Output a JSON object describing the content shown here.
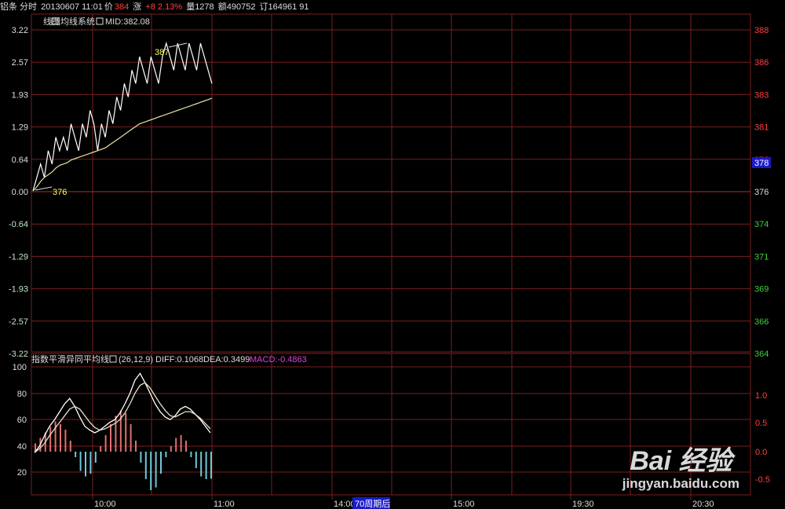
{
  "header": {
    "name": "铝条 分时",
    "date_time": "20130607 11:01",
    "price_label": "价",
    "price": "384",
    "change_label": "涨",
    "change": "+8 2.13%",
    "volume_label": "量",
    "volume": "1278",
    "amount_label": "额",
    "amount": "490752",
    "order_label": "订",
    "order": "164961 91"
  },
  "main_panel": {
    "legend_line": "线图",
    "legend_avg": "均线系统",
    "legend_mid": "MID:382.08",
    "pct_ticks": [
      "3.22",
      "2.57",
      "1.93",
      "1.29",
      "0.64",
      "0.00",
      "-0.64",
      "-1.29",
      "-1.93",
      "-2.57",
      "-3.22"
    ],
    "price_ticks": [
      "388",
      "386",
      "383",
      "381",
      "378",
      "376",
      "374",
      "371",
      "369",
      "366",
      "364"
    ],
    "current_price_tag": "378",
    "high_label": "387",
    "low_label": "376"
  },
  "macd_panel": {
    "title": "指数平滑异同平均线",
    "params": "(26,12,9)",
    "diff": "DIFF:0.1068",
    "dea": "DEA:0.3499",
    "macd": "MACD:-0.4863",
    "left_ticks": [
      "100",
      "80",
      "60",
      "40",
      "20"
    ],
    "right_ticks": [
      "1.0",
      "0.5",
      "0.0",
      "-0.5"
    ]
  },
  "time_axis": {
    "labels": [
      "10:00",
      "11:00",
      "14:00",
      "15:00",
      "19:30",
      "20:30"
    ],
    "badge": "70周期后"
  },
  "colors": {
    "grid": "#7a1f1f",
    "price_line": "#ffffff",
    "avg_line": "#e8e0a0",
    "label_yellow": "#ffff66",
    "up_red": "#ff4040",
    "down_green": "#3fcf3f",
    "macd_magenta": "#e040e0",
    "hist_up": "#e07070",
    "hist_down": "#70c8d8",
    "badge_bg": "#1a1ac8"
  },
  "watermark": {
    "brand": "Bai 经验",
    "url": "jingyan.baidu.com"
  },
  "chart_data": [
    {
      "type": "line",
      "x_unit": "minute index (session start)",
      "series": [
        {
          "values": [
            376,
            377,
            378,
            377,
            379,
            378,
            380,
            379,
            380,
            379,
            381,
            380,
            379,
            381,
            380,
            382,
            381,
            379,
            381,
            380,
            382,
            381,
            383,
            382,
            384,
            383,
            385,
            384,
            386,
            385,
            384,
            386,
            385,
            384,
            386,
            387,
            386,
            385,
            387,
            386,
            385,
            387,
            386,
            385,
            387,
            386,
            385,
            384
          ]
        },
        {
          "values": [
            376,
            376.3,
            376.7,
            377,
            377.2,
            377.4,
            377.7,
            377.9,
            378,
            378.1,
            378.3,
            378.4,
            378.5,
            378.6,
            378.7,
            378.8,
            378.9,
            379,
            379.1,
            379.2,
            379.4,
            379.6,
            379.8,
            380,
            380.2,
            380.4,
            380.6,
            380.8,
            381,
            381.1,
            381.2,
            381.3,
            381.4,
            381.5,
            381.6,
            381.7,
            381.8,
            381.9,
            382,
            382.1,
            382.2,
            382.3,
            382.4,
            382.5,
            382.6,
            382.7,
            382.8,
            382.9
          ]
        }
      ],
      "ylim": [
        364,
        388
      ]
    },
    {
      "type": "line",
      "series": [
        {
          "values": [
            35,
            40,
            48,
            55,
            60,
            66,
            72,
            76,
            70,
            62,
            55,
            52,
            50,
            52,
            55,
            58,
            60,
            65,
            72,
            80,
            90,
            95,
            88,
            80,
            72,
            66,
            62,
            60,
            63,
            68,
            70,
            68,
            64,
            60,
            55,
            50
          ]
        },
        {
          "values": [
            35,
            38,
            42,
            48,
            53,
            58,
            63,
            68,
            70,
            68,
            63,
            58,
            54,
            52,
            53,
            55,
            57,
            60,
            65,
            72,
            80,
            86,
            88,
            84,
            78,
            72,
            67,
            63,
            62,
            64,
            66,
            66,
            64,
            61,
            57,
            53
          ]
        },
        {
          "values": [
            0.15,
            0.25,
            0.35,
            0.45,
            0.55,
            0.5,
            0.4,
            0.2,
            -0.1,
            -0.35,
            -0.45,
            -0.4,
            -0.2,
            0.1,
            0.3,
            0.5,
            0.65,
            0.75,
            0.7,
            0.5,
            0.2,
            -0.2,
            -0.5,
            -0.7,
            -0.65,
            -0.4,
            -0.1,
            0.1,
            0.25,
            0.3,
            0.2,
            -0.1,
            -0.3,
            -0.45,
            -0.5,
            -0.49
          ]
        }
      ],
      "ylim": [
        0,
        100
      ]
    }
  ]
}
